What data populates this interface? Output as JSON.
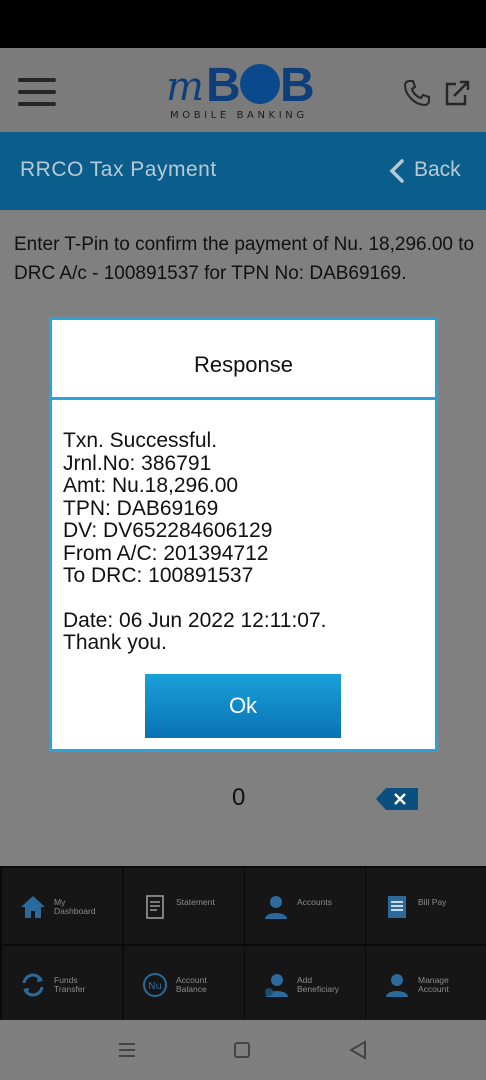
{
  "app": {
    "logo_m": "m",
    "logo_b": "B",
    "logo_subtitle": "MOBILE BANKING"
  },
  "title_bar": {
    "title": "RRCO Tax Payment",
    "back_label": "Back"
  },
  "content": {
    "confirm_message": "Enter T-Pin to confirm the payment of Nu. 18,296.00 to DRC A/c - 100891537 for TPN No: DAB69169.",
    "pin_value": "0"
  },
  "modal": {
    "title": "Response",
    "lines": [
      "Txn. Successful.",
      "Jrnl.No: 386791",
      "Amt: Nu.18,296.00",
      "TPN: DAB69169",
      "DV: DV652284606129",
      "From A/C: 201394712",
      "To DRC: 100891537"
    ],
    "date_line": "Date: 06 Jun 2022 12:11:07.",
    "thanks_line": "Thank you.",
    "ok_label": "Ok"
  },
  "bottom_nav": {
    "items": [
      {
        "label": "My\nDashboard",
        "icon": "home-icon"
      },
      {
        "label": "Statement",
        "icon": "statement-icon"
      },
      {
        "label": "Accounts",
        "icon": "accounts-icon"
      },
      {
        "label": "Bill Pay",
        "icon": "bill-pay-icon"
      },
      {
        "label": "Funds\nTransfer",
        "icon": "funds-transfer-icon"
      },
      {
        "label": "Account\nBalance",
        "icon": "account-balance-icon"
      },
      {
        "label": "Add\nBeneficiary",
        "icon": "add-beneficiary-icon"
      },
      {
        "label": "Manage\nAccount",
        "icon": "manage-account-icon"
      }
    ]
  },
  "colors": {
    "title_bar": "#0b5e8c",
    "modal_border": "#29a3dc",
    "ok_button": "#0a86c6",
    "logo_blue": "#0e3f7a"
  }
}
